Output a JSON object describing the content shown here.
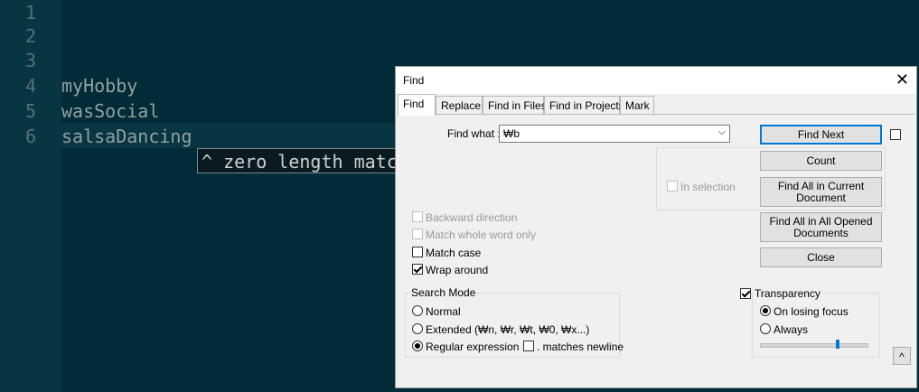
{
  "editor": {
    "line_numbers": [
      "1",
      "2",
      "3",
      "4",
      "5",
      "6"
    ],
    "lines": [
      "",
      "",
      "",
      "myHobby",
      "wasSocial",
      "salsaDancing"
    ],
    "tooltip": "^ zero length match"
  },
  "dialog": {
    "title": "Find",
    "close_glyph": "✕",
    "tabs": [
      "Find",
      "Replace",
      "Find in Files",
      "Find in Projects",
      "Mark"
    ],
    "find_what_label": "Find what :",
    "find_what_value": "₩b",
    "dropdown_glyph": "⌵",
    "in_selection_label": "In selection",
    "buttons": {
      "find_next": "Find Next",
      "count": "Count",
      "find_all_current": "Find All in Current Document",
      "find_all_opened": "Find All in All Opened Documents",
      "close": "Close"
    },
    "options": {
      "backward": "Backward direction",
      "whole_word": "Match whole word only",
      "match_case": "Match case",
      "wrap_around": "Wrap around"
    },
    "search_mode": {
      "title": "Search Mode",
      "normal": "Normal",
      "extended": "Extended (₩n, ₩r, ₩t, ₩0, ₩x...)",
      "regex": "Regular expression",
      "matches_newline": ". matches newline"
    },
    "transparency": {
      "title": "Transparency",
      "on_losing_focus": "On losing focus",
      "always": "Always",
      "level": 0.72
    },
    "expand_glyph": "^"
  }
}
